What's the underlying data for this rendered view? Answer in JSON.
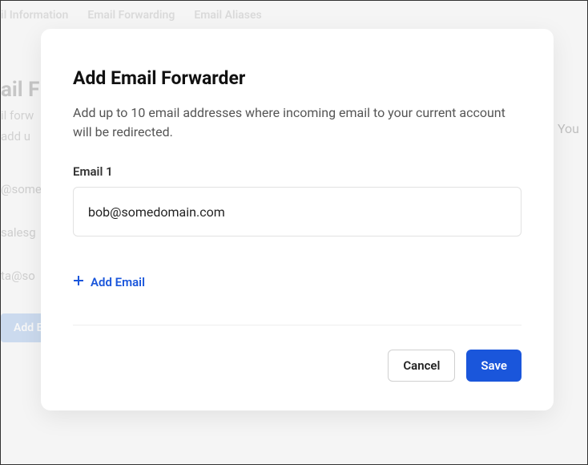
{
  "background": {
    "tabs": [
      "il Information",
      "Email Forwarding",
      "Email Aliases"
    ],
    "title_fragment": "ail F",
    "sub_fragment_1": "il forw",
    "sub_fragment_2": "add u",
    "sub_right": "You",
    "items": [
      "@some",
      "salesg",
      "ta@so"
    ],
    "add_button": "Add E"
  },
  "modal": {
    "title": "Add Email Forwarder",
    "description": "Add up to 10 email addresses where incoming email to your current account will be redirected.",
    "field_label": "Email 1",
    "field_value": "bob@somedomain.com",
    "add_email_label": "Add Email",
    "cancel_label": "Cancel",
    "save_label": "Save"
  }
}
